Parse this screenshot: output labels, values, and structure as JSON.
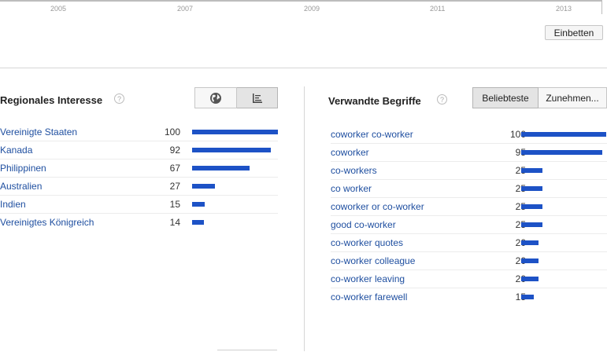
{
  "timeline": {
    "years": [
      "2005",
      "2007",
      "2009",
      "2011",
      "2013"
    ]
  },
  "embed_button": "Einbetten",
  "regional": {
    "title": "Regionales Interesse",
    "help": "?",
    "rows": [
      {
        "name": "Vereinigte Staaten",
        "value": 100
      },
      {
        "name": "Kanada",
        "value": 92
      },
      {
        "name": "Philippinen",
        "value": 67
      },
      {
        "name": "Australien",
        "value": 27
      },
      {
        "name": "Indien",
        "value": 15
      },
      {
        "name": "Vereinigtes Königreich",
        "value": 14
      }
    ]
  },
  "related": {
    "title": "Verwandte Begriffe",
    "help": "?",
    "tabs": [
      "Beliebteste",
      "Zunehmen..."
    ],
    "rows": [
      {
        "name": "coworker co-worker",
        "value": 100
      },
      {
        "name": "coworker",
        "value": 95
      },
      {
        "name": "co-workers",
        "value": 25
      },
      {
        "name": "co worker",
        "value": 25
      },
      {
        "name": "coworker or co-worker",
        "value": 25
      },
      {
        "name": "good co-worker",
        "value": 25
      },
      {
        "name": "co-worker quotes",
        "value": 20
      },
      {
        "name": "co-worker colleague",
        "value": 20
      },
      {
        "name": "co-worker leaving",
        "value": 20
      },
      {
        "name": "co-worker farewell",
        "value": 15
      }
    ]
  },
  "icons": {
    "map_view": "globe-icon",
    "list_view": "list-icon"
  },
  "colors": {
    "bar": "#1d52c6",
    "link": "#1f4fa0"
  }
}
